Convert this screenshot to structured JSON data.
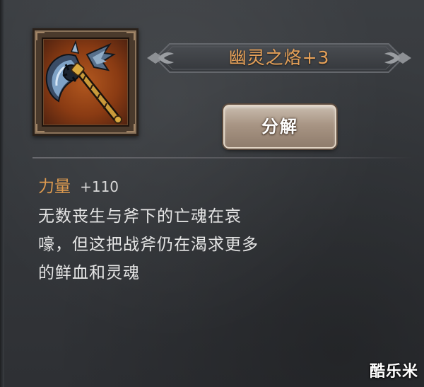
{
  "item": {
    "name": "幽灵之烙+3",
    "icon": "battle-axe-icon",
    "name_color": "#e5a058"
  },
  "actions": {
    "decompose_label": "分解"
  },
  "stats": [
    {
      "name": "力量",
      "value": "+110"
    }
  ],
  "description": {
    "lines": [
      "无数丧生与斧下的亡魂在哀",
      "嚎，但这把战斧仍在渴求更多",
      "的鲜血和灵魂"
    ]
  },
  "watermark": {
    "text": "酷乐米"
  },
  "colors": {
    "stat_label": "#dd9a4f",
    "panel_bg": "#383b3f",
    "frame_bg": "#8a3b13"
  }
}
